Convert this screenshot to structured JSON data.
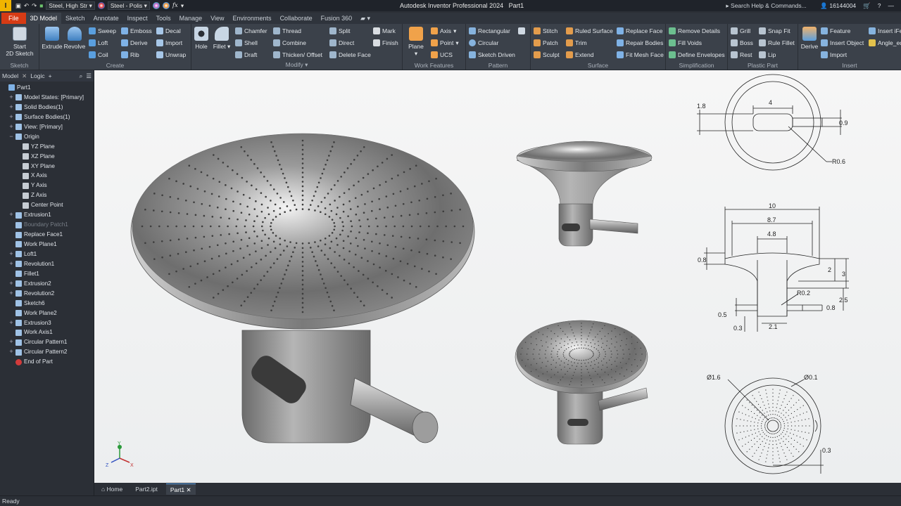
{
  "titlebar": {
    "app_title": "Autodesk Inventor Professional 2024",
    "doc_title": "Part1",
    "material": "Steel, High Str",
    "appearance": "Steel - Polis",
    "search_placeholder": "Search Help & Commands...",
    "user_id": "16144004",
    "fx_label": "fx"
  },
  "tabs": [
    "File",
    "3D Model",
    "Sketch",
    "Annotate",
    "Inspect",
    "Tools",
    "Manage",
    "View",
    "Environments",
    "Collaborate",
    "Fusion 360"
  ],
  "ribbon": {
    "sketch": {
      "label": "Sketch",
      "start_line1": "Start",
      "start_line2": "2D Sketch"
    },
    "create": {
      "label": "Create",
      "extrude": "Extrude",
      "revolve": "Revolve",
      "sweep": "Sweep",
      "loft": "Loft",
      "coil": "Coil",
      "emboss": "Emboss",
      "derive": "Derive",
      "rib": "Rib",
      "decal": "Decal",
      "import": "Import",
      "unwrap": "Unwrap"
    },
    "modify": {
      "label": "Modify",
      "hole": "Hole",
      "fillet": "Fillet",
      "chamfer": "Chamfer",
      "shell": "Shell",
      "draft": "Draft",
      "thread": "Thread",
      "combine": "Combine",
      "thicken": "Thicken/ Offset",
      "split": "Split",
      "direct": "Direct",
      "delete_face": "Delete Face"
    },
    "explore": {
      "mark": "Mark",
      "finish": "Finish"
    },
    "work": {
      "label": "Work Features",
      "plane": "Plane",
      "axis": "Axis",
      "point": "Point",
      "ucs": "UCS"
    },
    "pattern": {
      "label": "Pattern",
      "rectangular": "Rectangular",
      "circular": "Circular",
      "sketch_driven": "Sketch Driven"
    },
    "surface": {
      "label": "Surface",
      "stitch": "Stitch",
      "patch": "Patch",
      "sculpt": "Sculpt",
      "ruled": "Ruled Surface",
      "trim": "Trim",
      "extend": "Extend",
      "replace_face": "Replace Face",
      "repair": "Repair Bodies",
      "fit_mesh": "Fit Mesh Face"
    },
    "simplification": {
      "label": "Simplification",
      "remove_details": "Remove Details",
      "fill_voids": "Fill Voids",
      "define_env": "Define Envelopes"
    },
    "plastic": {
      "label": "Plastic Part",
      "grill": "Grill",
      "boss": "Boss",
      "rest": "Rest",
      "snap_fit": "Snap Fit",
      "rule_fillet": "Rule Fillet",
      "lip": "Lip"
    },
    "insert": {
      "label": "Insert",
      "derive": "Derive",
      "feature": "Feature",
      "insert_object": "Insert Object",
      "import": "Import",
      "insert_ifeature": "Insert iFe",
      "angle_eq": "Angle_eq"
    }
  },
  "browser": {
    "tab_model": "Model",
    "tab_logic": "Logic",
    "items": [
      {
        "label": "Part1",
        "level": 0,
        "pm": ""
      },
      {
        "label": "Model States: [Primary]",
        "level": 1,
        "pm": "+"
      },
      {
        "label": "Solid Bodies(1)",
        "level": 1,
        "pm": "+"
      },
      {
        "label": "Surface Bodies(1)",
        "level": 1,
        "pm": "+"
      },
      {
        "label": "View: [Primary]",
        "level": 1,
        "pm": "+"
      },
      {
        "label": "Origin",
        "level": 1,
        "pm": "−"
      },
      {
        "label": "YZ Plane",
        "level": 2,
        "pm": ""
      },
      {
        "label": "XZ Plane",
        "level": 2,
        "pm": ""
      },
      {
        "label": "XY Plane",
        "level": 2,
        "pm": ""
      },
      {
        "label": "X Axis",
        "level": 2,
        "pm": ""
      },
      {
        "label": "Y Axis",
        "level": 2,
        "pm": ""
      },
      {
        "label": "Z Axis",
        "level": 2,
        "pm": ""
      },
      {
        "label": "Center Point",
        "level": 2,
        "pm": ""
      },
      {
        "label": "Extrusion1",
        "level": 1,
        "pm": "+"
      },
      {
        "label": "Boundary Patch1",
        "level": 1,
        "pm": "",
        "dim": true
      },
      {
        "label": "Replace Face1",
        "level": 1,
        "pm": ""
      },
      {
        "label": "Work Plane1",
        "level": 1,
        "pm": ""
      },
      {
        "label": "Loft1",
        "level": 1,
        "pm": "+"
      },
      {
        "label": "Revolution1",
        "level": 1,
        "pm": "+"
      },
      {
        "label": "Fillet1",
        "level": 1,
        "pm": ""
      },
      {
        "label": "Extrusion2",
        "level": 1,
        "pm": "+"
      },
      {
        "label": "Revolution2",
        "level": 1,
        "pm": "+"
      },
      {
        "label": "Sketch6",
        "level": 1,
        "pm": ""
      },
      {
        "label": "Work Plane2",
        "level": 1,
        "pm": ""
      },
      {
        "label": "Extrusion3",
        "level": 1,
        "pm": "+"
      },
      {
        "label": "Work Axis1",
        "level": 1,
        "pm": ""
      },
      {
        "label": "Circular Pattern1",
        "level": 1,
        "pm": "+"
      },
      {
        "label": "Circular Pattern2",
        "level": 1,
        "pm": "+"
      },
      {
        "label": "End of Part",
        "level": 1,
        "pm": ""
      }
    ]
  },
  "drawing": {
    "top": {
      "d_4": "4",
      "d_18": "1.8",
      "d_09": "0.9",
      "r_06": "R0.6"
    },
    "front": {
      "d_10": "10",
      "d_87": "8.7",
      "d_48": "4.8",
      "d_08a": "0.8",
      "d_2": "2",
      "d_3": "3",
      "r_02": "R0.2",
      "d_25": "2.5",
      "d_05": "0.5",
      "d_08b": "0.8",
      "d_03": "0.3",
      "d_21": "2.1"
    },
    "bottom": {
      "dia16": "Ø1.6",
      "dia01": "Ø0.1",
      "d_03": "0.3"
    }
  },
  "triad": {
    "x": "X",
    "y": "Y",
    "z": "Z"
  },
  "doctabs": {
    "home": "Home",
    "part2": "Part2.ipt",
    "part1": "Part1"
  },
  "status": "Ready",
  "colors": {
    "file_tab": "#d63b15",
    "accent": "#5aa0e6",
    "viewport_bg": "#f2f3f4"
  }
}
